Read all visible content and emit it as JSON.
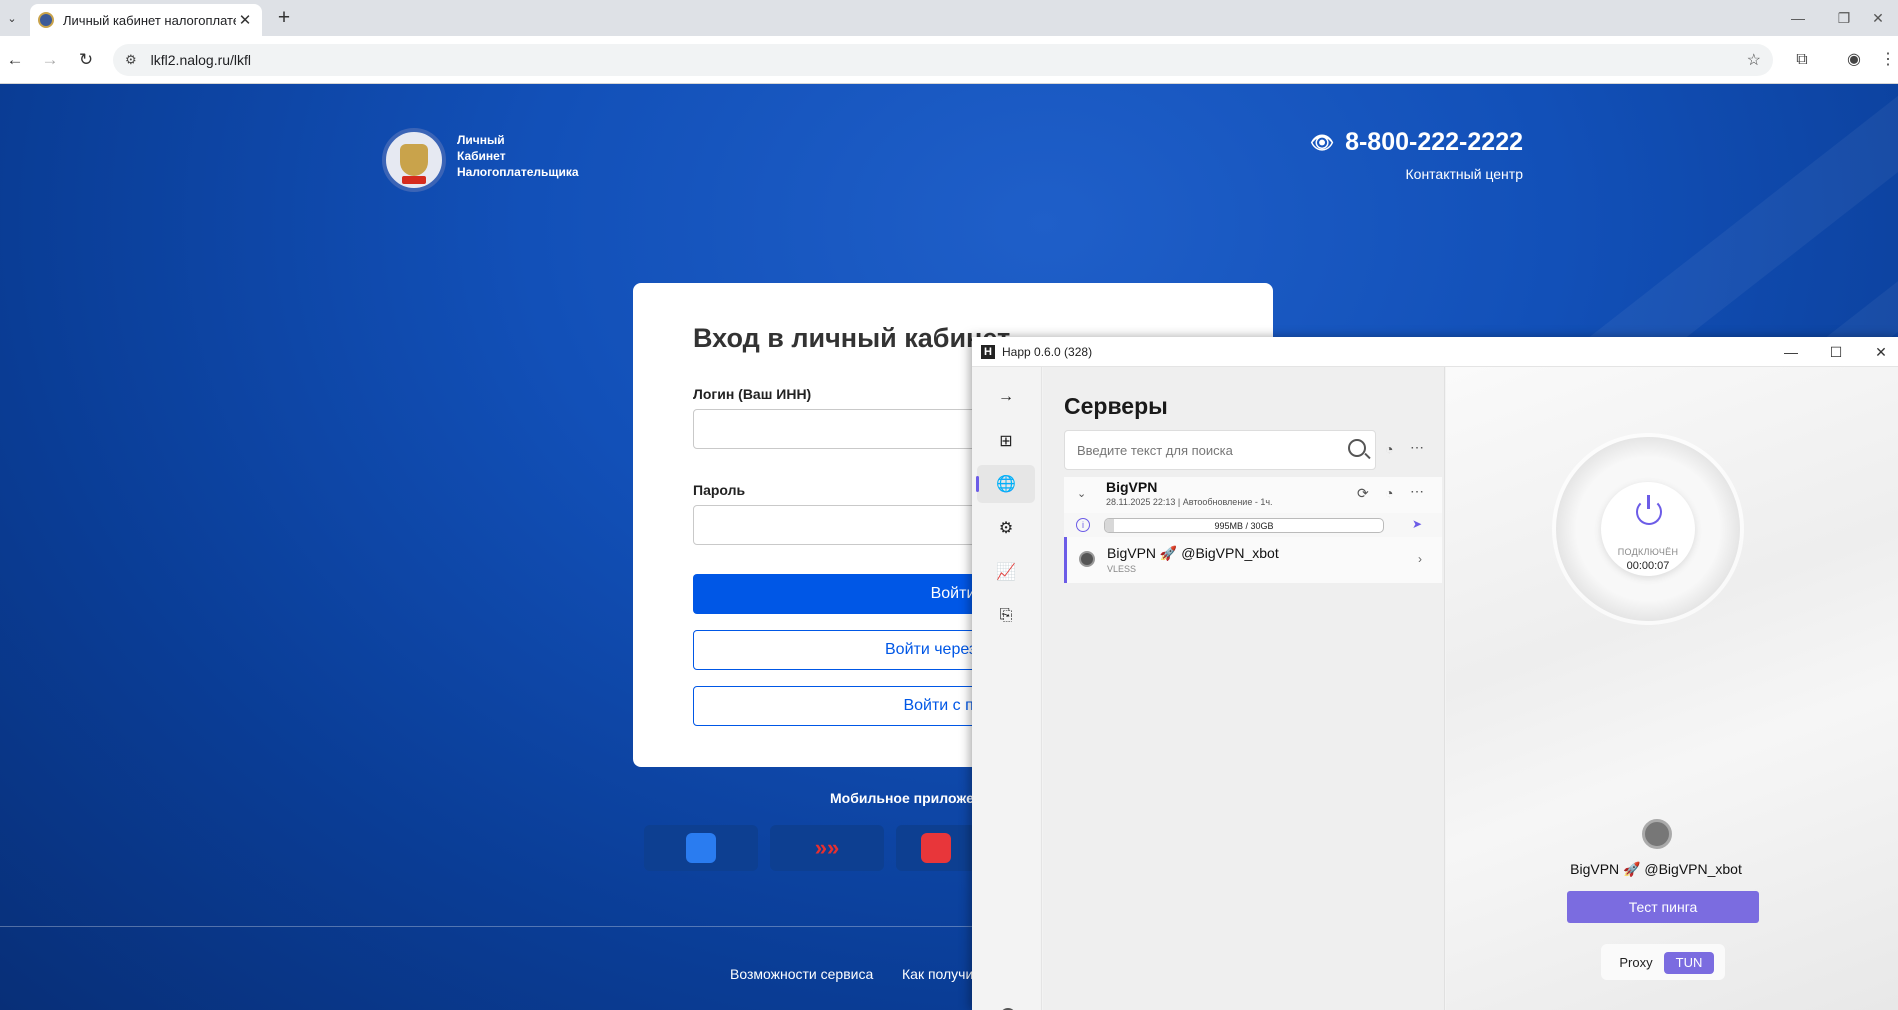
{
  "browser": {
    "tab_title": "Личный кабинет налогоплате",
    "url": "lkfl2.nalog.ru/lkfl"
  },
  "site": {
    "brand_line1": "Личный",
    "brand_line2": "Кабинет",
    "brand_line3": "Налогоплательщика",
    "phone": "8-800-222-2222",
    "contact_center": "Контактный центр",
    "login_title": "Вход в личный кабинет",
    "login_label": "Логин (Ваш ИНН)",
    "password_label": "Пароль",
    "login_button": "Войти",
    "gosuslugi_button": "Войти через Госус",
    "other_login_button": "Войти с помо",
    "mobile_apps_title": "Мобильное приложе",
    "footer_link1": "Возможности сервиса",
    "footer_link2": "Как получи"
  },
  "happ": {
    "window_title": "Happ 0.6.0 (328)",
    "servers_title": "Серверы",
    "search_placeholder": "Введите текст для поиска",
    "group": {
      "name": "BigVPN",
      "subtitle": "28.11.2025 22:13 | Автообновление - 1ч.",
      "usage_text": "995MB / 30GB",
      "usage_fraction": 0.032
    },
    "server": {
      "name": "BigVPN 🚀 @BigVPN_xbot",
      "protocol": "VLESS"
    },
    "status_label": "ПОДКЛЮЧЁН",
    "status_time": "00:00:07",
    "selected_server": "BigVPN 🚀 @BigVPN_xbot",
    "ping_button": "Тест пинга",
    "mode_proxy": "Proxy",
    "mode_tun": "TUN",
    "accent_color": "#7b6ce0"
  },
  "colors": {
    "site_blue": "#1250b8",
    "primary_button": "#0057e6"
  }
}
